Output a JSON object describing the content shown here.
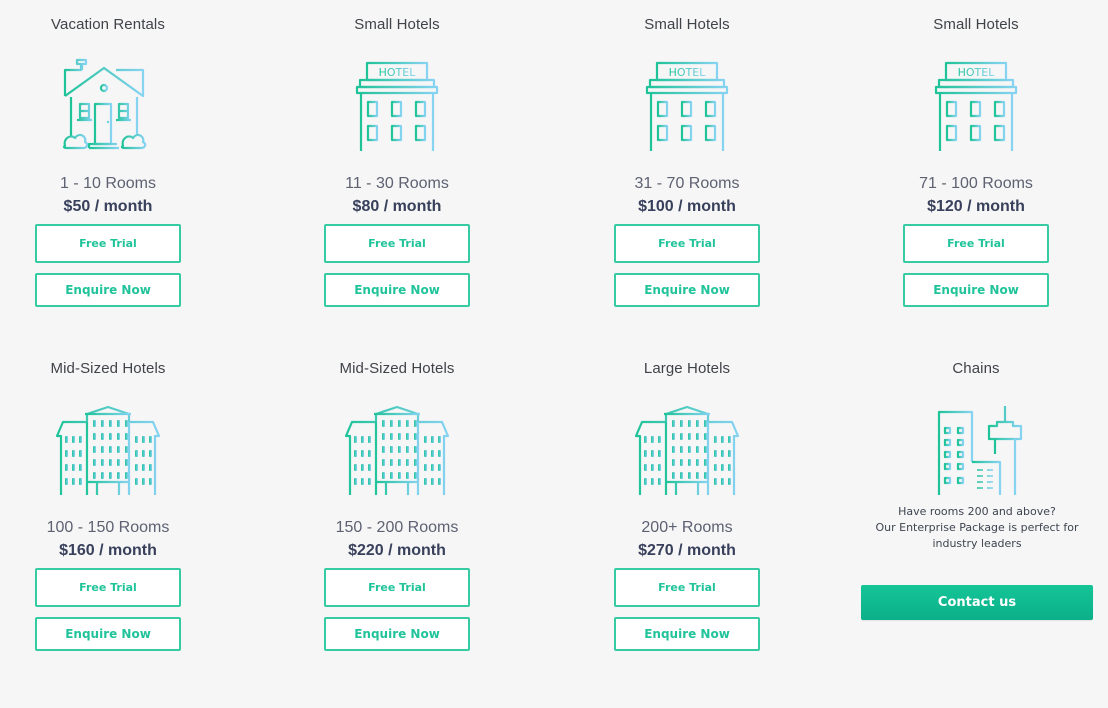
{
  "colors": {
    "accent": "#21c49a",
    "accent_border": "#37cba4",
    "icon_gradient_start": "#1fc398",
    "icon_gradient_end": "#86d3f2",
    "price_text": "#39405c",
    "background": "#f6f6f6"
  },
  "plans": [
    {
      "title": "Vacation Rentals",
      "icon": "house-icon",
      "rooms": "1 - 10 Rooms",
      "price": "$50 / month",
      "free_trial_label": "Free Trial",
      "enquire_label": "Enquire Now"
    },
    {
      "title": "Small Hotels",
      "icon": "hotel-icon",
      "icon_sign": "HOTEL",
      "rooms": "11 - 30 Rooms",
      "price": "$80 / month",
      "free_trial_label": "Free Trial",
      "enquire_label": "Enquire Now"
    },
    {
      "title": "Small Hotels",
      "icon": "hotel-icon",
      "icon_sign": "HOTEL",
      "rooms": "31 - 70 Rooms",
      "price": "$100 / month",
      "free_trial_label": "Free Trial",
      "enquire_label": "Enquire Now"
    },
    {
      "title": "Small Hotels",
      "icon": "hotel-icon",
      "icon_sign": "HOTEL",
      "rooms": "71 - 100 Rooms",
      "price": "$120 / month",
      "free_trial_label": "Free Trial",
      "enquire_label": "Enquire Now"
    },
    {
      "title": "Mid-Sized Hotels",
      "icon": "large-building-icon",
      "rooms": "100 - 150 Rooms",
      "price": "$160 / month",
      "free_trial_label": "Free Trial",
      "enquire_label": "Enquire Now"
    },
    {
      "title": "Mid-Sized Hotels",
      "icon": "large-building-icon",
      "rooms": "150 - 200 Rooms",
      "price": "$220 / month",
      "free_trial_label": "Free Trial",
      "enquire_label": "Enquire Now"
    },
    {
      "title": "Large Hotels",
      "icon": "large-building-icon",
      "rooms": "200+ Rooms",
      "price": "$270 / month",
      "free_trial_label": "Free Trial",
      "enquire_label": "Enquire Now"
    }
  ],
  "enterprise": {
    "title": "Chains",
    "icon": "city-skyline-icon",
    "text_line1": "Have rooms 200 and above?",
    "text_line2": "Our Enterprise Package is perfect for",
    "text_line3": "industry leaders",
    "contact_label": "Contact us"
  }
}
